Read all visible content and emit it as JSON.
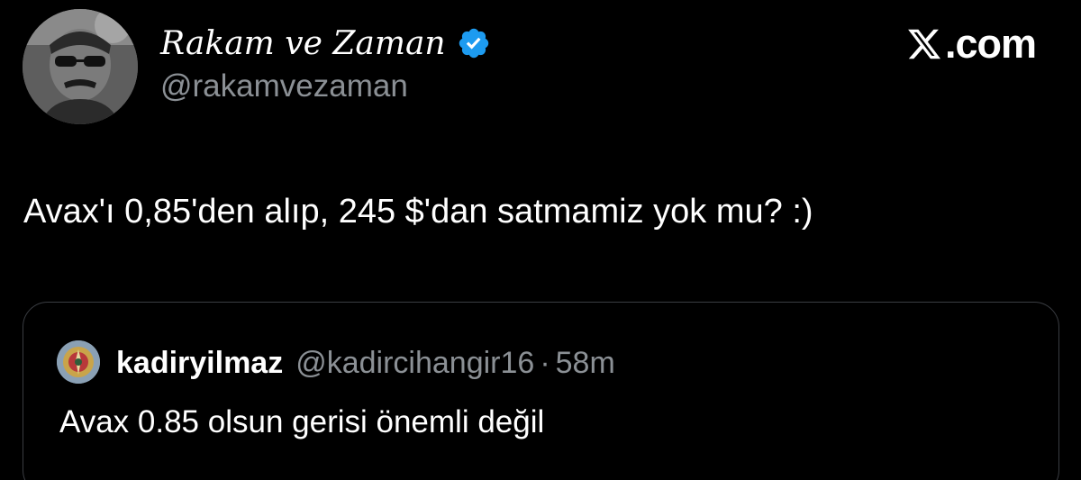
{
  "brand": {
    "label": ".com",
    "icon": "x-logo-icon"
  },
  "author": {
    "display_name": "Rakam ve Zaman",
    "handle": "@rakamvezaman",
    "verified": true,
    "verified_color": "#1d9bf0"
  },
  "tweet": {
    "text": "Avax'ı 0,85'den alıp, 245 $'dan satmamiz yok mu? :)"
  },
  "quoted_tweet": {
    "display_name": "kadiryilmaz",
    "handle": "@kadircihangir16",
    "separator": "·",
    "time": "58m",
    "text": "Avax 0.85 olsun gerisi önemli değil"
  },
  "colors": {
    "background": "#000000",
    "primary_text": "#ffffff",
    "secondary_text": "#8b9095",
    "border": "#3a3d42"
  }
}
